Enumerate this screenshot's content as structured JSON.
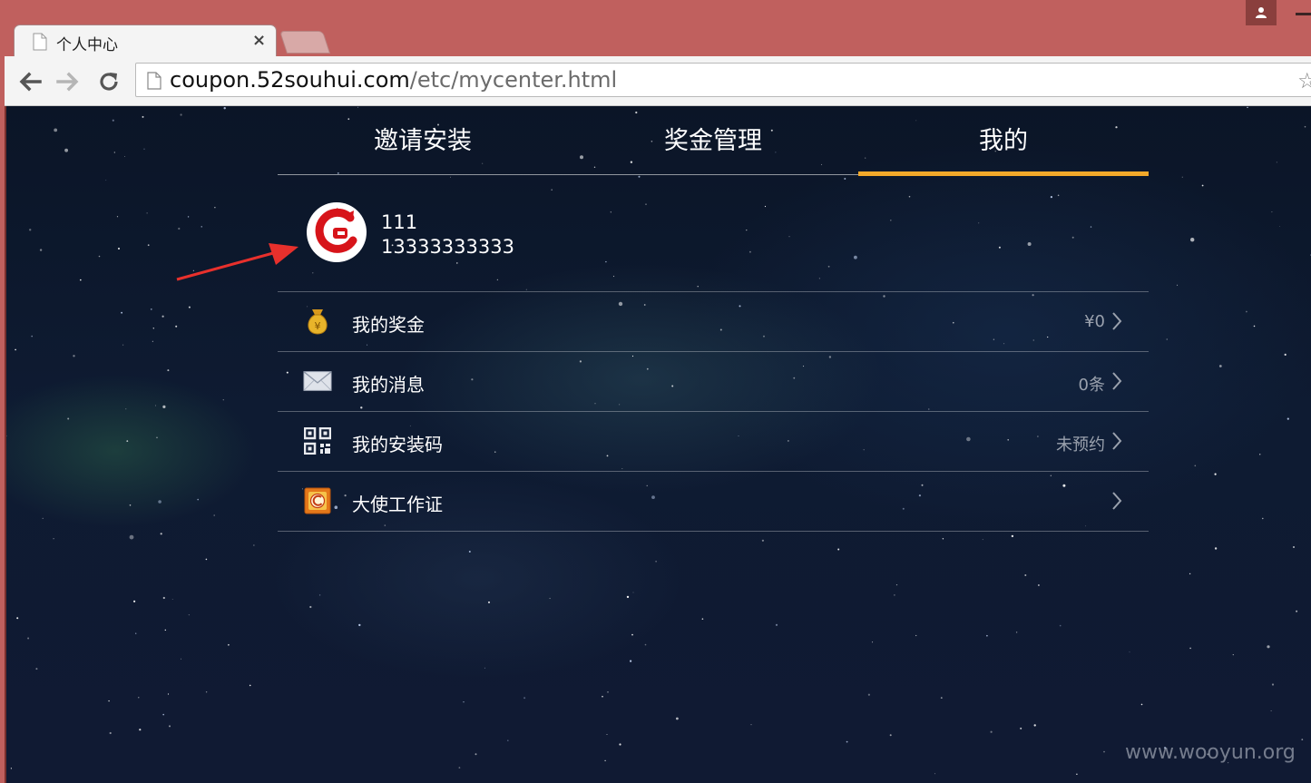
{
  "browser": {
    "tab_title": "个人中心",
    "tab_close": "×",
    "url_host": "coupon.52souhui.com",
    "url_path": "/etc/mycenter.html",
    "star": "☆"
  },
  "nav": {
    "tabs": [
      {
        "label": "邀请安装",
        "active": false
      },
      {
        "label": "奖金管理",
        "active": false
      },
      {
        "label": "我的",
        "active": true
      }
    ],
    "active_color": "#f3a92a"
  },
  "profile": {
    "name": "111",
    "phone": "13333333333",
    "logo_color": "#d7141a"
  },
  "menu": {
    "items": [
      {
        "label": "我的奖金",
        "value": "¥0",
        "icon": "money-bag-icon"
      },
      {
        "label": "我的消息",
        "value": "0条",
        "icon": "envelope-icon"
      },
      {
        "label": "我的安装码",
        "value": "未预约",
        "icon": "qr-code-icon"
      },
      {
        "label": "大使工作证",
        "value": "",
        "icon": "badge-icon"
      }
    ]
  },
  "watermark": "www.wooyun.org"
}
